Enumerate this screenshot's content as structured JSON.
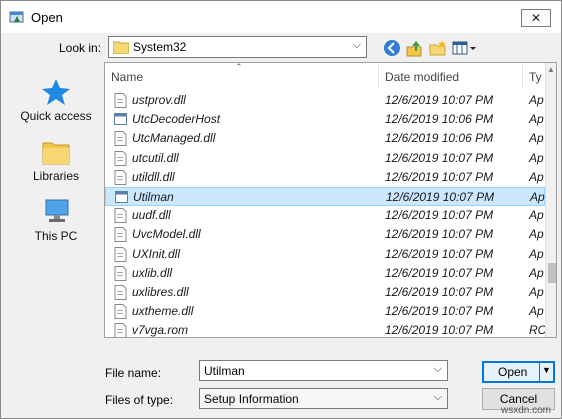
{
  "window": {
    "title": "Open",
    "close_glyph": "✕"
  },
  "lookin": {
    "label": "Look in:",
    "value": "System32"
  },
  "toolbar": {
    "icons": [
      "back-icon",
      "up-folder-icon",
      "new-folder-icon",
      "view-menu-icon"
    ]
  },
  "places": [
    {
      "label": "Quick access",
      "icon": "star-icon"
    },
    {
      "label": "Libraries",
      "icon": "libraries-icon"
    },
    {
      "label": "This PC",
      "icon": "computer-icon"
    }
  ],
  "filelist": {
    "columns": {
      "name": "Name",
      "date": "Date modified",
      "type": "Ty"
    },
    "rows": [
      {
        "name": "ustprov.dll",
        "date": "12/6/2019 10:07 PM",
        "type": "Ap",
        "icon": "dll",
        "selected": false
      },
      {
        "name": "UtcDecoderHost",
        "date": "12/6/2019 10:06 PM",
        "type": "Ap",
        "icon": "exe",
        "selected": false
      },
      {
        "name": "UtcManaged.dll",
        "date": "12/6/2019 10:06 PM",
        "type": "Ap",
        "icon": "dll",
        "selected": false
      },
      {
        "name": "utcutil.dll",
        "date": "12/6/2019 10:07 PM",
        "type": "Ap",
        "icon": "dll",
        "selected": false
      },
      {
        "name": "utildll.dll",
        "date": "12/6/2019 10:07 PM",
        "type": "Ap",
        "icon": "dll",
        "selected": false
      },
      {
        "name": "Utilman",
        "date": "12/6/2019 10:07 PM",
        "type": "Ap",
        "icon": "exe",
        "selected": true
      },
      {
        "name": "uudf.dll",
        "date": "12/6/2019 10:07 PM",
        "type": "Ap",
        "icon": "dll",
        "selected": false
      },
      {
        "name": "UvcModel.dll",
        "date": "12/6/2019 10:07 PM",
        "type": "Ap",
        "icon": "dll",
        "selected": false
      },
      {
        "name": "UXInit.dll",
        "date": "12/6/2019 10:07 PM",
        "type": "Ap",
        "icon": "dll",
        "selected": false
      },
      {
        "name": "uxlib.dll",
        "date": "12/6/2019 10:07 PM",
        "type": "Ap",
        "icon": "dll",
        "selected": false
      },
      {
        "name": "uxlibres.dll",
        "date": "12/6/2019 10:07 PM",
        "type": "Ap",
        "icon": "dll",
        "selected": false
      },
      {
        "name": "uxtheme.dll",
        "date": "12/6/2019 10:07 PM",
        "type": "Ap",
        "icon": "dll",
        "selected": false
      },
      {
        "name": "v7vga.rom",
        "date": "12/6/2019 10:07 PM",
        "type": "RC",
        "icon": "dll",
        "selected": false
      }
    ]
  },
  "filename": {
    "label": "File name:",
    "value": "Utilman"
  },
  "filetype": {
    "label": "Files of type:",
    "value": "Setup Information"
  },
  "buttons": {
    "open": "Open",
    "cancel": "Cancel"
  },
  "watermark": "wsxdn.com",
  "colors": {
    "selection": "#cce8ff",
    "accent": "#0078d7"
  }
}
